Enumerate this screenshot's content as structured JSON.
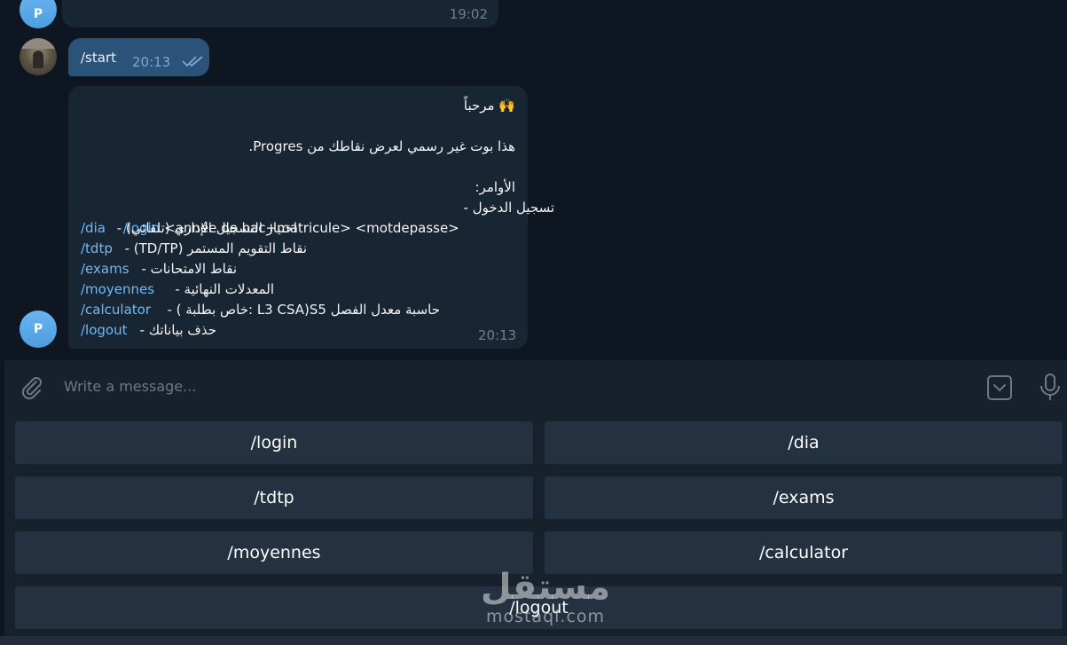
{
  "messages": [
    {
      "id": "prev-bot",
      "time": "19:02",
      "avatar_letter": "P"
    },
    {
      "id": "user-start",
      "text": "/start",
      "time": "20:13",
      "read_status": "double-check-icon"
    },
    {
      "id": "bot-welcome",
      "avatar_letter": "P",
      "time": "20:13",
      "greeting": "🙌 مرحباً",
      "intro": "هذا بوت غير رسمي لعرض نقاطك من Progres.",
      "commands_header": "الأوامر:",
      "commands": [
        {
          "cmd": "/login",
          "desc": "تسجيل الدخول - ",
          "args": " <année de bac+matricule> <motdepasse>"
        },
        {
          "cmd": "/dia",
          "desc": "اختيار التسجيل الإداري (تلقائي) - ",
          "args": ""
        },
        {
          "cmd": "/tdtp",
          "desc": "نقاط التقويم المستمر (TD/TP) - ",
          "args": ""
        },
        {
          "cmd": "/exams",
          "desc": "نقاط الامتحانات - ",
          "args": ""
        },
        {
          "cmd": "/moyennes",
          "desc": "المعدلات النهائية - ",
          "args": ""
        },
        {
          "cmd": "/calculator",
          "desc": "حاسبة معدل الفصل S5(L3 CSA :خاص بطلبة ) - ",
          "args": ""
        },
        {
          "cmd": "/logout",
          "desc": "حذف بياناتك - ",
          "args": ""
        }
      ]
    }
  ],
  "input": {
    "placeholder": "Write a message...",
    "attach_icon": "paperclip-icon",
    "keyboard_icon": "keyboard-toggle-icon",
    "mic_icon": "microphone-icon"
  },
  "keyboard_buttons": [
    "/login",
    "/dia",
    "/tdtp",
    "/exams",
    "/moyennes",
    "/calculator",
    "/logout"
  ],
  "watermark": {
    "arabic": "مستقل",
    "latin": "mostaql.com"
  },
  "colors": {
    "background": "#0e1621",
    "bubble_in": "#182533",
    "bubble_out": "#2b5278",
    "link": "#71baf7",
    "button": "#243140"
  }
}
